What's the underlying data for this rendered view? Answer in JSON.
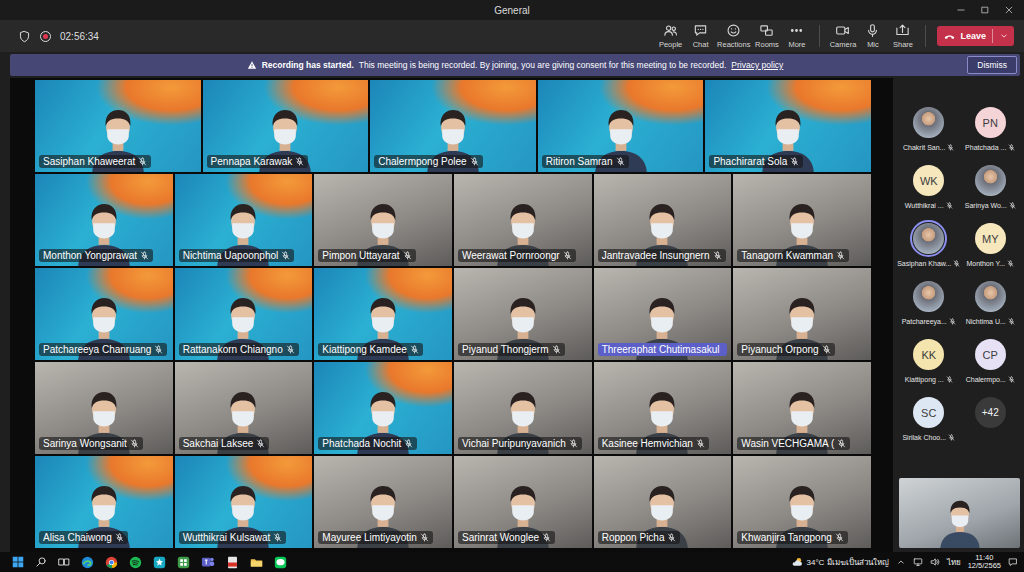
{
  "window": {
    "title": "General"
  },
  "meeting": {
    "timer": "02:56:34",
    "recording": true
  },
  "toolbar": {
    "buttons": [
      {
        "label": "People",
        "kind": "people"
      },
      {
        "label": "Chat",
        "kind": "chat"
      },
      {
        "label": "Reactions",
        "kind": "reactions"
      },
      {
        "label": "Rooms",
        "kind": "rooms"
      },
      {
        "label": "More",
        "kind": "more"
      },
      {
        "label": "Camera",
        "kind": "camera"
      },
      {
        "label": "Mic",
        "kind": "mic"
      },
      {
        "label": "Share",
        "kind": "share"
      }
    ],
    "leave": {
      "label": "Leave"
    }
  },
  "banner": {
    "title": "Recording has started.",
    "message": "This meeting is being recorded. By joining, you are giving consent for this meeting to be recorded.",
    "link": "Privacy policy",
    "dismiss": "Dismiss"
  },
  "grid": {
    "rows": [
      [
        {
          "name": "Sasiphan Khaweerat",
          "muted": true,
          "speaking": false,
          "kind": "branded"
        },
        {
          "name": "Pennapa Karawak",
          "muted": true,
          "speaking": false,
          "kind": "branded"
        },
        {
          "name": "Chalermpong Polee",
          "muted": true,
          "speaking": false,
          "kind": "branded"
        },
        {
          "name": "Ritiron Samran",
          "muted": true,
          "speaking": false,
          "kind": "branded"
        },
        {
          "name": "Phachirarat Sola",
          "muted": true,
          "speaking": false,
          "kind": "branded"
        }
      ],
      [
        {
          "name": "Monthon Yongprawat",
          "muted": true,
          "speaking": false,
          "kind": "branded"
        },
        {
          "name": "Nichtima Uapoonphol",
          "muted": true,
          "speaking": false,
          "kind": "branded"
        },
        {
          "name": "Pimpon Uttayarat",
          "muted": true,
          "speaking": false,
          "kind": "camera"
        },
        {
          "name": "Weerawat Pornroongr",
          "muted": true,
          "speaking": false,
          "kind": "camera"
        },
        {
          "name": "Jantravadee Insungnern",
          "muted": true,
          "speaking": false,
          "kind": "camera"
        },
        {
          "name": "Tanagorn Kwamman",
          "muted": true,
          "speaking": false,
          "kind": "camera"
        }
      ],
      [
        {
          "name": "Patchareeya Chanruang",
          "muted": true,
          "speaking": false,
          "kind": "branded"
        },
        {
          "name": "Rattanakorn Chiangno",
          "muted": true,
          "speaking": false,
          "kind": "branded"
        },
        {
          "name": "Kiattipong Kamdee",
          "muted": true,
          "speaking": false,
          "kind": "branded"
        },
        {
          "name": "Piyanud Thongjerm",
          "muted": true,
          "speaking": false,
          "kind": "camera"
        },
        {
          "name": "Threeraphat Chutimasakul",
          "muted": false,
          "speaking": true,
          "kind": "camera"
        },
        {
          "name": "Piyanuch Orpong",
          "muted": true,
          "speaking": false,
          "kind": "camera"
        }
      ],
      [
        {
          "name": "Sarinya Wongsanit",
          "muted": true,
          "speaking": false,
          "kind": "camera"
        },
        {
          "name": "Sakchai Laksee",
          "muted": true,
          "speaking": false,
          "kind": "camera"
        },
        {
          "name": "Phatchada Nochit",
          "muted": true,
          "speaking": false,
          "kind": "branded"
        },
        {
          "name": "Vichai Puripunyavanich",
          "muted": true,
          "speaking": false,
          "kind": "camera"
        },
        {
          "name": "Kasinee Hemvichian",
          "muted": true,
          "speaking": false,
          "kind": "camera"
        },
        {
          "name": "Wasin VECHGAMA (",
          "muted": true,
          "speaking": false,
          "kind": "camera"
        }
      ],
      [
        {
          "name": "Alisa Chaiwong",
          "muted": true,
          "speaking": false,
          "kind": "branded"
        },
        {
          "name": "Wutthikrai Kulsawat",
          "muted": true,
          "speaking": false,
          "kind": "branded"
        },
        {
          "name": "Mayuree Limtiyayotin",
          "muted": true,
          "speaking": false,
          "kind": "camera"
        },
        {
          "name": "Sarinrat Wonglee",
          "muted": true,
          "speaking": false,
          "kind": "camera"
        },
        {
          "name": "Roppon Picha",
          "muted": true,
          "speaking": false,
          "kind": "camera"
        },
        {
          "name": "Khwanjira Tangpong",
          "muted": true,
          "speaking": false,
          "kind": "camera"
        }
      ]
    ]
  },
  "participants": {
    "items": [
      {
        "name": "Chakrit San...",
        "kind": "photo",
        "muted": true,
        "speaking": false
      },
      {
        "name": "Phatchada ...",
        "kind": "initials",
        "initials": "PN",
        "color": "#f5d4d8",
        "muted": true,
        "speaking": false
      },
      {
        "name": "Wutthikrai ...",
        "kind": "initials",
        "initials": "WK",
        "color": "#f6e7bd",
        "muted": true,
        "speaking": false
      },
      {
        "name": "Sarinya Wo...",
        "kind": "photo",
        "muted": true,
        "speaking": false
      },
      {
        "name": "Sasiphan Khaw...",
        "kind": "photo",
        "muted": true,
        "speaking": true
      },
      {
        "name": "Monthon Y...",
        "kind": "initials",
        "initials": "MY",
        "color": "#f6e7bd",
        "muted": true,
        "speaking": false
      },
      {
        "name": "Patchareeya...",
        "kind": "photo",
        "muted": true,
        "speaking": false
      },
      {
        "name": "Nichtima U...",
        "kind": "photo",
        "muted": true,
        "speaking": false
      },
      {
        "name": "Kiattipong ...",
        "kind": "initials",
        "initials": "KK",
        "color": "#f4e4ad",
        "muted": true,
        "speaking": false
      },
      {
        "name": "Chalermpo...",
        "kind": "initials",
        "initials": "CP",
        "color": "#e6e1f4",
        "muted": true,
        "speaking": false
      },
      {
        "name": "Sirilak Choo...",
        "kind": "initials",
        "initials": "SC",
        "color": "#dde7f4",
        "muted": true,
        "speaking": false
      }
    ],
    "overflow": "+42"
  },
  "taskbar": {
    "weather": "34°C มีเมฆเป็นส่วนใหญ่",
    "language": "ไทย",
    "time": "11:40",
    "date": "12/5/2565"
  }
}
